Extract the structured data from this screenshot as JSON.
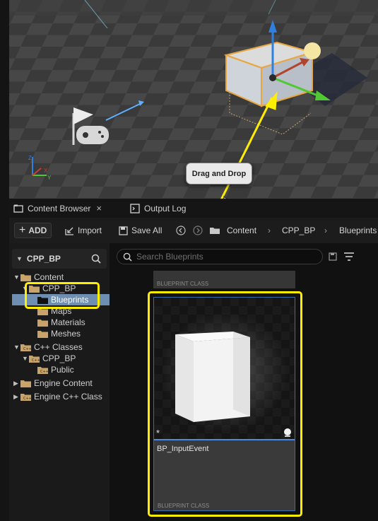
{
  "annotation": {
    "tooltip": "Drag and Drop",
    "highlight_color": "#ffee00"
  },
  "tabs": [
    {
      "label": "Content Browser",
      "icon": "content-browser-icon",
      "close": "×"
    },
    {
      "label": "Output Log",
      "icon": "output-log-icon"
    }
  ],
  "toolbar": {
    "add_label": "ADD",
    "import_label": "Import",
    "save_all_label": "Save All",
    "breadcrumb": [
      "Content",
      "CPP_BP",
      "Blueprints"
    ]
  },
  "sources": {
    "title": "CPP_BP",
    "tree": [
      {
        "label": "Content"
      },
      {
        "label": "CPP_BP"
      },
      {
        "label": "Blueprints"
      },
      {
        "label": "Maps"
      },
      {
        "label": "Materials"
      },
      {
        "label": "Meshes"
      },
      {
        "label": "C++ Classes"
      },
      {
        "label": "CPP_BP"
      },
      {
        "label": "Public"
      },
      {
        "label": "Engine Content"
      },
      {
        "label": "Engine C++ Class"
      }
    ]
  },
  "assets": {
    "search_placeholder": "Search Blueprints",
    "top_card_type": "BLUEPRINT CLASS",
    "selected_card": {
      "name": "BP_InputEvent",
      "type": "BLUEPRINT CLASS"
    }
  },
  "colors": {
    "selection": "#6e8fb1",
    "card_border": "#3d6aa8",
    "folder": "#c8a46a"
  }
}
